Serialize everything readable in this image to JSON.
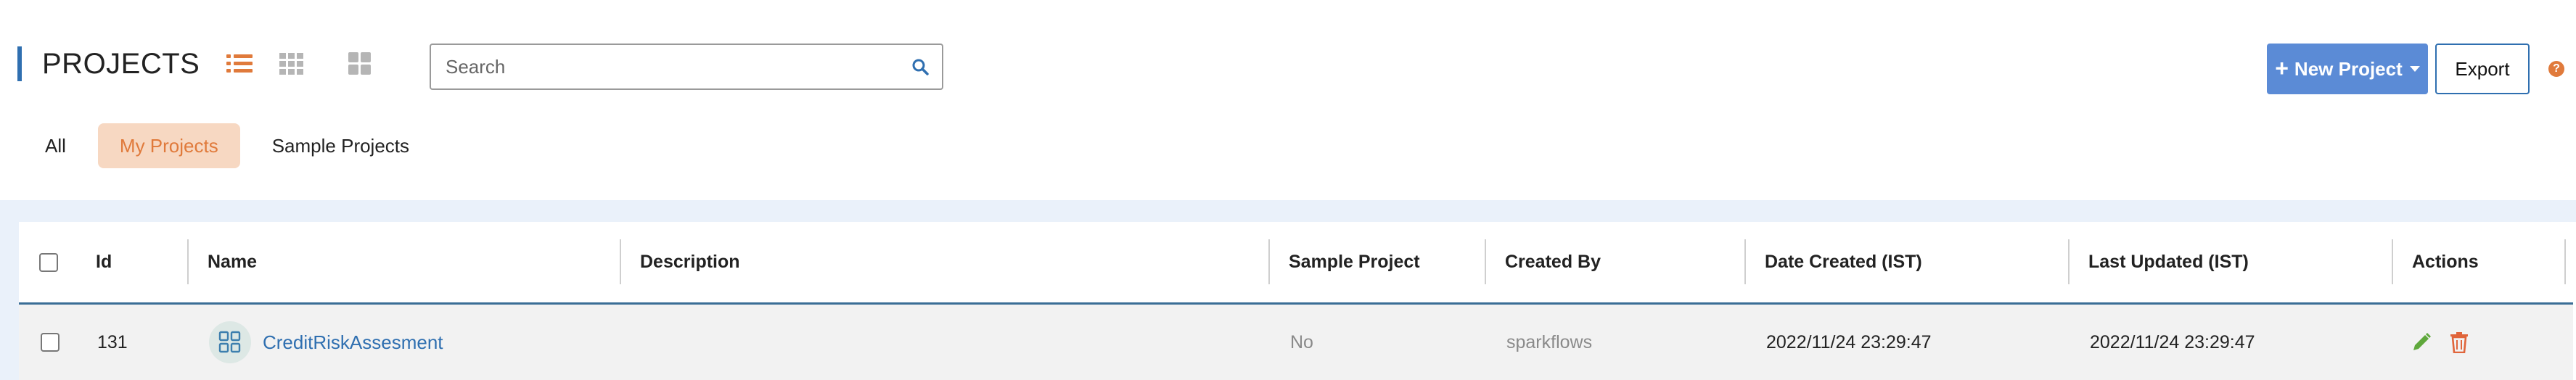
{
  "header": {
    "title": "PROJECTS",
    "view_icons": [
      "list-view-icon",
      "grid-view-icon",
      "tile-view-icon"
    ],
    "search": {
      "placeholder": "Search",
      "value": ""
    },
    "new_project_label": "New Project",
    "export_label": "Export",
    "help_label": "?"
  },
  "tabs": [
    {
      "label": "All",
      "active": false
    },
    {
      "label": "My Projects",
      "active": true
    },
    {
      "label": "Sample Projects",
      "active": false
    }
  ],
  "table": {
    "columns": [
      "Id",
      "Name",
      "Description",
      "Sample Project",
      "Created By",
      "Date Created (IST)",
      "Last Updated (IST)",
      "Actions"
    ],
    "rows": [
      {
        "id": "131",
        "name": "CreditRiskAssesment",
        "description": "",
        "sample_project": "No",
        "created_by": "sparkflows",
        "date_created": "2022/11/24 23:29:47",
        "last_updated": "2022/11/24 23:29:47",
        "actions": [
          "edit-icon",
          "delete-icon"
        ]
      }
    ]
  },
  "colors": {
    "accent_orange": "#e07a3b",
    "primary_blue": "#5b8bd6",
    "link_blue": "#2f6fb0",
    "active_tab_bg": "#f7d8c2",
    "table_bg": "#eaf1fa",
    "edit_green": "#5fa83c",
    "delete_orange": "#e0653b"
  }
}
